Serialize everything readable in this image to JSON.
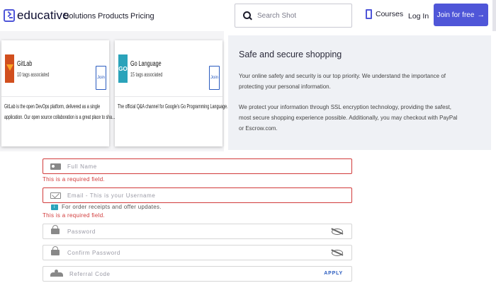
{
  "header": {
    "logo_text": "educative",
    "nav": [
      "Solutions",
      "Products",
      "Pricing"
    ],
    "search_placeholder": "Search Shot",
    "courses_label": "Courses",
    "login_label": "Log In",
    "join_label": "Join for free",
    "join_arrow": "→"
  },
  "cards": [
    {
      "name": "GitLab",
      "subtitle": "10 tags associated",
      "join_label": "Join",
      "description_lines": [
        "GitLab is the open DevOps platform, delivered as a single",
        "application. Our open source collaboration is a great place to sha..."
      ]
    },
    {
      "name": "Go Language",
      "subtitle": "15 tags associated",
      "icon_text": "GO",
      "join_label": "Join",
      "description_lines": [
        "The official Q&A channel for Google's Go Programming Language."
      ]
    }
  ],
  "secure": {
    "title": "Safe and secure shopping",
    "p1_line1": "Your online safety and security is our top priority. We understand the importance of",
    "p1_line2": "protecting your personal information.",
    "p2_line1": "We protect your information through SSL encryption technology, providing the safest,",
    "p2_line2": "most secure shopping experience possible. Additionally, you may checkout with PayPal",
    "p2_line3": "or Escrow.com."
  },
  "form": {
    "full_name_placeholder": "Full Name",
    "email_placeholder": "Email - This is your Username",
    "required_error": "This is a required field.",
    "email_note": "For order receipts and offer updates.",
    "password_placeholder": "Password",
    "confirm_placeholder": "Confirm Password",
    "referral_placeholder": "Referral Code",
    "apply_label": "APPLY"
  },
  "colors": {
    "brand": "#4f56d8",
    "error": "#d13a3a",
    "link": "#2a5bbf"
  }
}
